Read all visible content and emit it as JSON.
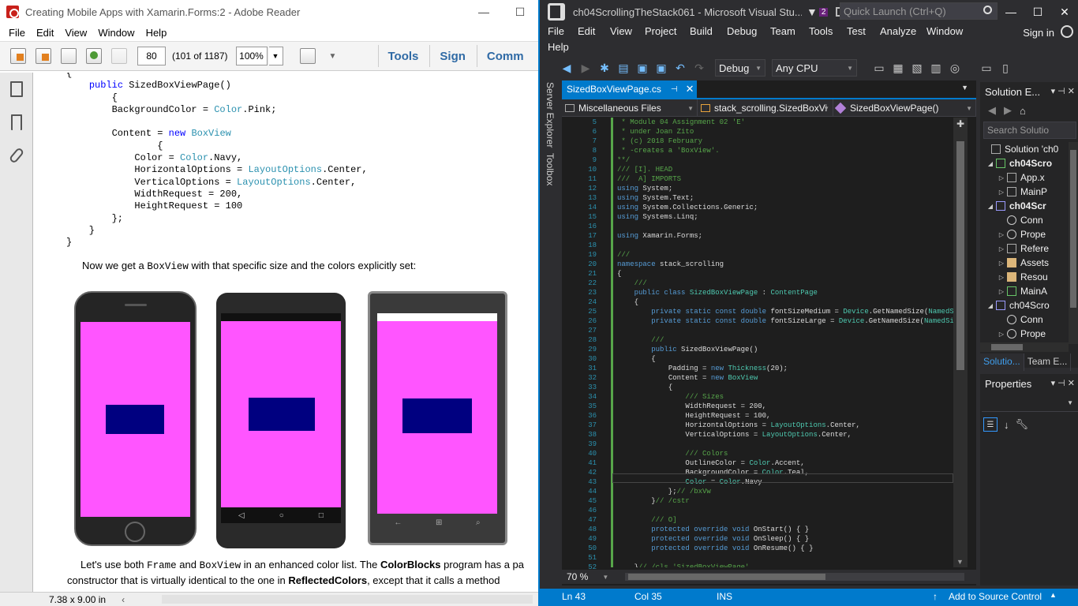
{
  "reader": {
    "title": "Creating Mobile Apps with Xamarin.Forms:2 - Adobe Reader",
    "menu": [
      "File",
      "Edit",
      "View",
      "Window",
      "Help"
    ],
    "page_number": "80",
    "page_info": "(101 of 1187)",
    "zoom": "100%",
    "links": [
      "Tools",
      "Sign",
      "Comm"
    ],
    "code_lines": [
      "{",
      "    public SizedBoxViewPage()",
      "    {",
      "        BackgroundColor = Color.Pink;",
      "",
      "        Content = new BoxView",
      "        {",
      "            Color = Color.Navy,",
      "            HorizontalOptions = LayoutOptions.Center,",
      "            VerticalOptions = LayoutOptions.Center,",
      "            WidthRequest = 200,",
      "            HeightRequest = 100",
      "        };",
      "    }",
      "}"
    ],
    "para1_a": "Now we get a ",
    "para1_mono": "BoxView",
    "para1_b": " with that specific size and the colors explicitly set:",
    "para2_a": "Let's use both ",
    "para2_m1": "Frame",
    "para2_b": " and ",
    "para2_m2": "BoxView",
    "para2_c": " in an enhanced color list. The ",
    "para2_bold": "ColorBlocks",
    "para2_d": " program has a pa",
    "para3_a": "constructor that is virtually identical to the one in ",
    "para3_bold": "ReflectedColors",
    "para3_b": ", except that it calls a method",
    "page_size": "7.38 x 9.00 in",
    "colors": {
      "pink": "#ff55ff",
      "navy": "#000080"
    }
  },
  "vs": {
    "title": "ch04ScrollingTheStack061 - Microsoft Visual Stu...",
    "notifications": "2",
    "quick_launch": "Quick Launch (Ctrl+Q)",
    "menu": [
      "File",
      "Edit",
      "View",
      "Project",
      "Build",
      "Debug",
      "Team",
      "Tools",
      "Test",
      "Analyze",
      "Window",
      "Help"
    ],
    "sign_in": "Sign in",
    "config": "Debug",
    "platform": "Any CPU",
    "doc_tab": "SizedBoxViewPage.cs",
    "left_tabs": [
      "Server Explorer",
      "Toolbox"
    ],
    "nav": [
      "Miscellaneous Files",
      "stack_scrolling.SizedBoxVi",
      "SizedBoxViewPage()"
    ],
    "line_numbers": [
      "5",
      "6",
      "7",
      "8",
      "9",
      "10",
      "11",
      "12",
      "13",
      "14",
      "15",
      "16",
      "17",
      "18",
      "19",
      "20",
      "21",
      "22",
      "23",
      "24",
      "25",
      "26",
      "27",
      "28",
      "29",
      "30",
      "31",
      "32",
      "33",
      "34",
      "35",
      "36",
      "37",
      "38",
      "39",
      "40",
      "41",
      "42",
      "43",
      "44",
      "45",
      "46",
      "47",
      "48",
      "49",
      "50",
      "51",
      "52"
    ],
    "code_lines": [
      " * Module 04 Assignment 02 'E'",
      " * under Joan Zito",
      " * (c) 2018 February",
      " * -creates a 'BoxView'.",
      "**/",
      "/// [I]. HEAD",
      "///  A] IMPORTS",
      "using System;",
      "using System.Text;",
      "using System.Collections.Generic;",
      "using Systems.Linq;",
      "",
      "using Xamarin.Forms;",
      "",
      "///",
      "namespace stack_scrolling",
      "{",
      "    ///",
      "    public class SizedBoxViewPage : ContentPage",
      "    {",
      "        private static const double fontSizeMedium = Device.GetNamedSize(NamedSize.Medi",
      "        private static const double fontSizeLarge = Device.GetNamedSize(NamedSize.Large",
      "",
      "        ///",
      "        public SizedBoxViewPage()",
      "        {",
      "            Padding = new Thickness(20);",
      "            Content = new BoxView",
      "            {",
      "                /// Sizes",
      "                WidthRequest = 200,",
      "                HeightRequest = 100,",
      "                HorizontalOptions = LayoutOptions.Center,",
      "                VerticalOptions = LayoutOptions.Center,",
      "",
      "                /// Colors",
      "                OutlineColor = Color.Accent,",
      "                BackgroundColor = Color.Teal,",
      "                Color = Color.Navy",
      "            };// /bxVw",
      "        }// /cstr",
      "",
      "        /// O]",
      "        protected override void OnStart() { }",
      "        protected override void OnSleep() { }",
      "        protected override void OnResume() { }",
      "",
      "    }// /cls 'SizedBoxViewPage'"
    ],
    "zoom": "70 %",
    "solution_explorer": {
      "title": "Solution E...",
      "search": "Search Solutio",
      "items": [
        "Solution 'ch0",
        "ch04Scro",
        "App.x",
        "MainP",
        "ch04Scr",
        "Conn",
        "Prope",
        "Refere",
        "Assets",
        "Resou",
        "MainA",
        "ch04Scro",
        "Conn",
        "Prope"
      ],
      "tabs": [
        "Solutio...",
        "Team E..."
      ]
    },
    "properties_title": "Properties",
    "status": {
      "ln": "Ln 43",
      "col": "Col 35",
      "ins": "INS",
      "source_control": "Add to Source Control"
    },
    "colors": {
      "accent": "#007acc",
      "bg": "#2d2d30",
      "editor": "#1e1e1e"
    }
  }
}
